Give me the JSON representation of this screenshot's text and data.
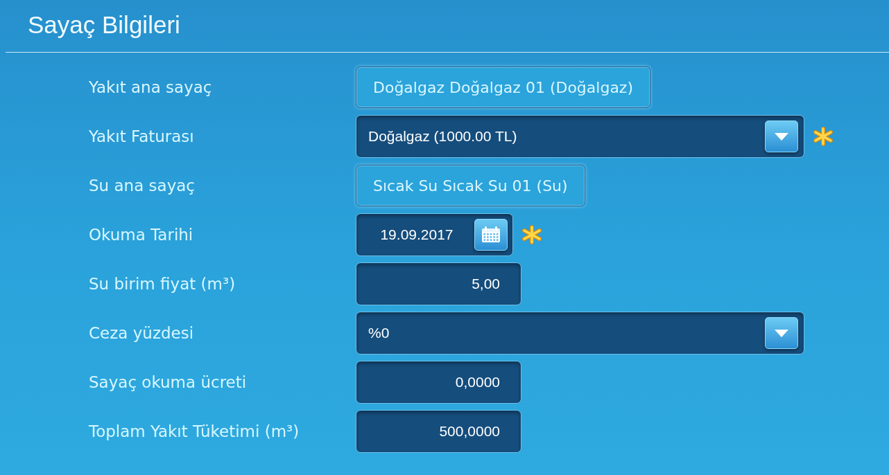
{
  "title": "Sayaç Bilgileri",
  "fields": [
    {
      "label": "Yakıt ana sayaç",
      "kind": "button",
      "value": "Doğalgaz Doğalgaz 01 (Doğalgaz)",
      "required": false
    },
    {
      "label": "Yakıt Faturası",
      "kind": "select",
      "value": "Doğalgaz (1000.00 TL)",
      "required": true
    },
    {
      "label": "Su ana sayaç",
      "kind": "button",
      "value": "Sıcak Su Sıcak Su 01 (Su)",
      "required": false
    },
    {
      "label": "Okuma Tarihi",
      "kind": "date",
      "value": "19.09.2017",
      "required": true
    },
    {
      "label": "Su birim fiyat (m³)",
      "kind": "number",
      "value": "5,00",
      "required": false
    },
    {
      "label": "Ceza yüzdesi",
      "kind": "select",
      "value": "%0",
      "required": false
    },
    {
      "label": "Sayaç okuma ücreti",
      "kind": "number",
      "value": "0,0000",
      "required": false
    },
    {
      "label": "Toplam Yakıt Tüketimi (m³)",
      "kind": "number",
      "value": "500,0000",
      "required": false
    }
  ]
}
